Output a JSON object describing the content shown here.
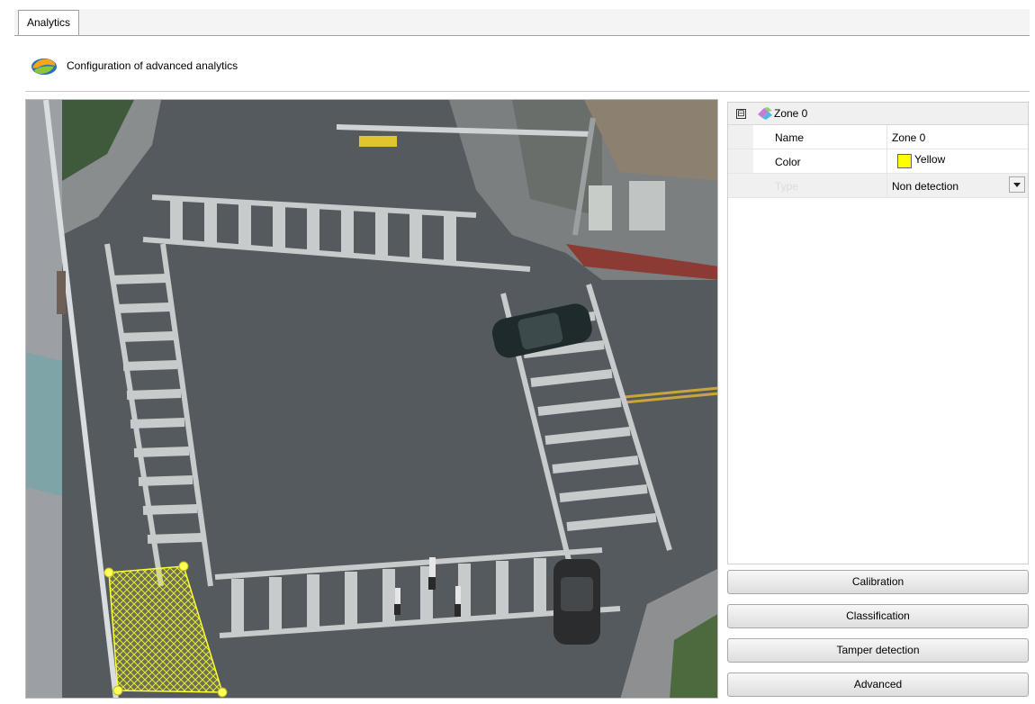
{
  "tabs": [
    {
      "label": "Analytics",
      "active": true
    }
  ],
  "header": {
    "title": "Configuration of advanced analytics",
    "icon": "analytics-logo-icon"
  },
  "property_grid": {
    "category": {
      "label": "Zone 0",
      "expander": "⊟",
      "icon": "zone-icon"
    },
    "rows": [
      {
        "name": "Name",
        "value": "Zone 0"
      },
      {
        "name": "Color",
        "value": "Yellow",
        "swatch": "#ffff00"
      },
      {
        "name": "Type",
        "value": "Non detection",
        "control": "dropdown"
      }
    ]
  },
  "buttons": {
    "calibration": "Calibration",
    "classification": "Classification",
    "tamper": "Tamper detection",
    "advanced": "Advanced"
  },
  "video": {
    "description_icon": "camera-view-icon",
    "zone_color": "#ffff00"
  }
}
